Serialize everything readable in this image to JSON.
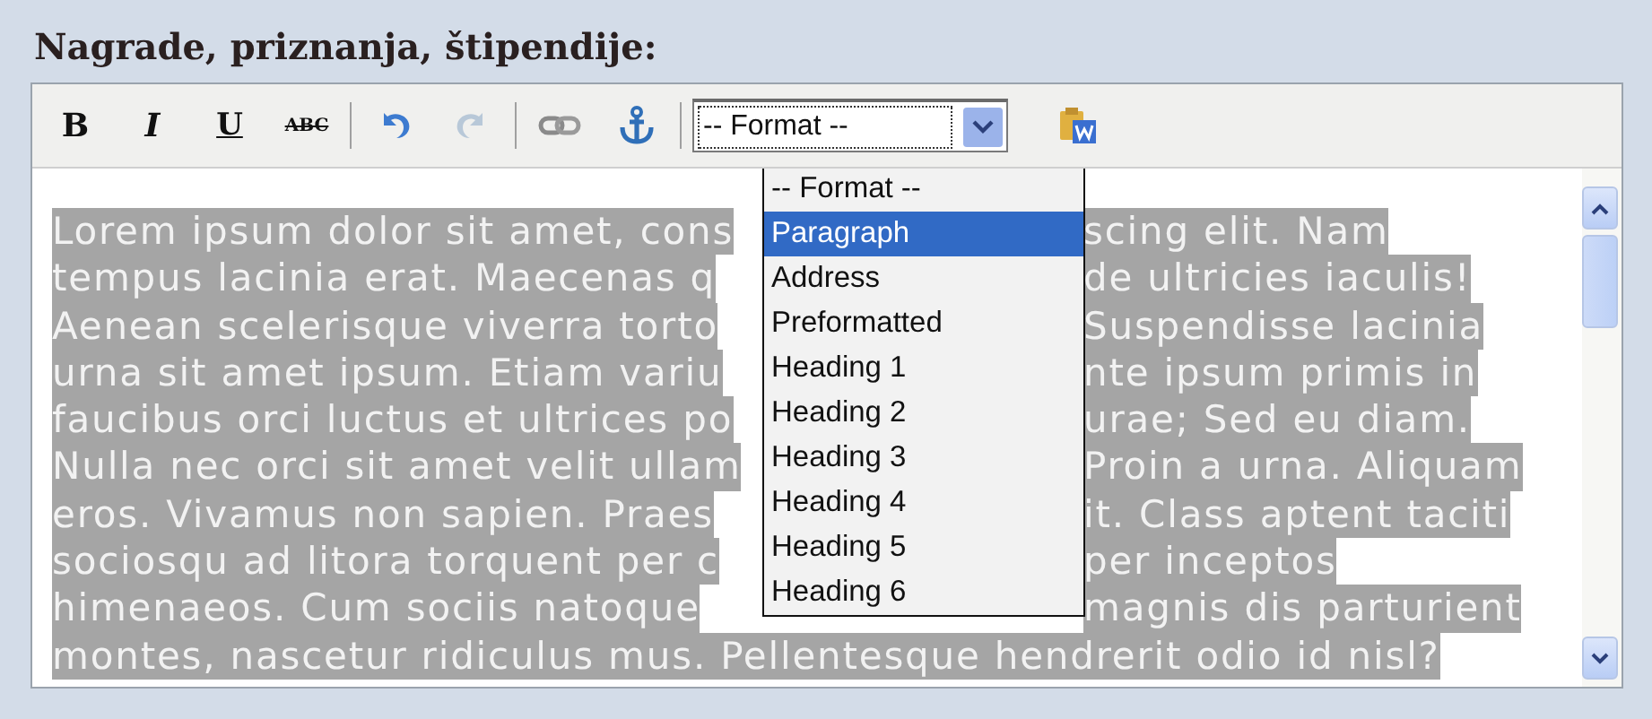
{
  "heading": "Nagrade, priznanja, štipendije:",
  "toolbar": [
    {
      "kind": "bold",
      "label": "B"
    },
    {
      "kind": "italic",
      "label": "I"
    },
    {
      "kind": "underline",
      "label": "U"
    },
    {
      "kind": "strike",
      "label": "ABC"
    },
    {
      "kind": "separator"
    },
    {
      "kind": "undo",
      "disabled": false
    },
    {
      "kind": "redo",
      "disabled": true
    },
    {
      "kind": "separator"
    },
    {
      "kind": "link"
    },
    {
      "kind": "anchor"
    },
    {
      "kind": "separator"
    },
    {
      "kind": "format",
      "value": "-- Format --"
    },
    {
      "kind": "paste-word"
    }
  ],
  "format_menu": [
    {
      "label": "-- Format --",
      "selected": false
    },
    {
      "label": "Paragraph",
      "selected": true
    },
    {
      "label": "Address",
      "selected": false
    },
    {
      "label": "Preformatted",
      "selected": false
    },
    {
      "label": "Heading 1",
      "selected": false
    },
    {
      "label": "Heading 2",
      "selected": false
    },
    {
      "label": "Heading 3",
      "selected": false
    },
    {
      "label": "Heading 4",
      "selected": false
    },
    {
      "label": "Heading 5",
      "selected": false
    },
    {
      "label": "Heading 6",
      "selected": false
    }
  ],
  "lines": [
    {
      "left": "Lorem ipsum dolor sit amet, cons",
      "right": "scing elit. Nam"
    },
    {
      "left": "tempus lacinia erat. Maecenas q",
      "right": "de ultricies iaculis!"
    },
    {
      "left": "Aenean scelerisque viverra torto",
      "right": "Suspendisse lacinia"
    },
    {
      "left": "urna sit amet ipsum. Etiam variu",
      "right": "nte ipsum primis in"
    },
    {
      "left": "faucibus orci luctus et ultrices po",
      "right": "urae; Sed eu diam."
    },
    {
      "left": "Nulla nec orci sit amet velit ullam",
      "right": "Proin a urna. Aliquam"
    },
    {
      "left": "eros. Vivamus non sapien. Praes",
      "right": "it. Class aptent taciti"
    },
    {
      "left": "sociosqu ad litora torquent per c",
      "right": "per inceptos"
    },
    {
      "left": "himenaeos. Cum sociis natoque",
      "right": "magnis dis parturient"
    },
    {
      "full": "montes, nascetur ridiculus mus. Pellentesque hendrerit odio id nisl?"
    }
  ]
}
